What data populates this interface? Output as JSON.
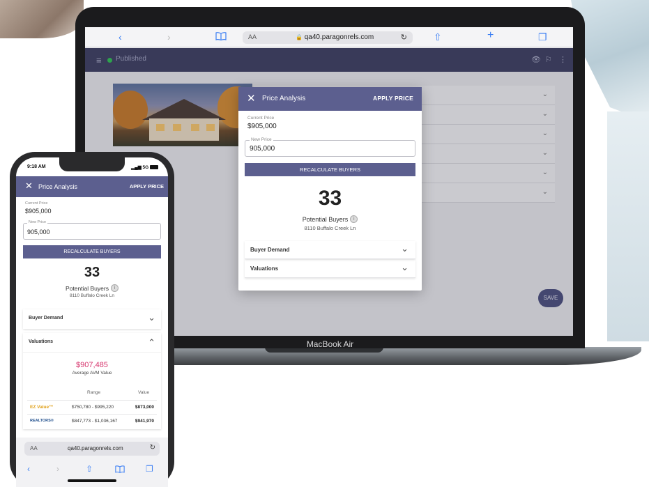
{
  "laptop": {
    "device_label": "MacBook Air",
    "browser": {
      "back_icon": "‹",
      "forward_icon": "›",
      "bookmarks_icon": "book-icon",
      "text_size": "AA",
      "url": "qa40.paragonrels.com",
      "lock_icon": "🔒",
      "reload_icon": "↻",
      "share_icon": "⇧",
      "new_tab_icon": "+",
      "tabs_icon": "❐"
    },
    "app_bar": {
      "menu_icon": "≡",
      "status": "Published",
      "status_color": "#2fbf52",
      "right_icons": [
        "👁",
        "⚐",
        "⋮"
      ]
    },
    "accordion_chevrons": [
      "⌄",
      "⌄",
      "⌄",
      "⌄",
      "⌄",
      "⌄"
    ],
    "save_button": "SAVE",
    "modal": {
      "title": "Price Analysis",
      "close_icon": "✕",
      "apply_label": "APPLY PRICE",
      "current_price_label": "Current Price",
      "current_price": "$905,000",
      "new_price_label": "New Price",
      "new_price": "905,000",
      "recalc_label": "RECALCULATE BUYERS",
      "count": "33",
      "potential_label": "Potential Buyers",
      "address": "8110 Buffalo Creek Ln",
      "sections": [
        "Buyer Demand",
        "Valuations"
      ],
      "chevron": "⌄"
    }
  },
  "phone": {
    "status_time": "9:18 AM",
    "status_signal": "5G",
    "title": "Price Analysis",
    "close_icon": "✕",
    "apply_label": "APPLY PRICE",
    "current_price_label": "Current Price",
    "current_price": "$905,000",
    "new_price_label": "New Price",
    "new_price": "905,000",
    "recalc_label": "RECALCULATE BUYERS",
    "count": "33",
    "potential_label": "Potential Buyers",
    "address": "8110 Buffalo Creek Ln",
    "buyer_demand_label": "Buyer Demand",
    "valuations_label": "Valuations",
    "chevron_down": "⌄",
    "chevron_up": "⌃",
    "avm_value": "$907,485",
    "avm_label": "Average AVM Value",
    "table": {
      "col_range": "Range",
      "col_value": "Value",
      "rows": [
        {
          "logo": "EZ Value™",
          "range": "$750,780 - $995,220",
          "value": "$873,000"
        },
        {
          "logo": "REALTORS®",
          "range": "$847,773 - $1,036,167",
          "value": "$941,970"
        }
      ]
    },
    "browser": {
      "text_size": "AA",
      "url": "qa40.paragonrels.com",
      "reload_icon": "↻",
      "nav": [
        "‹",
        "›",
        "⇧",
        "📖",
        "❐"
      ]
    }
  }
}
